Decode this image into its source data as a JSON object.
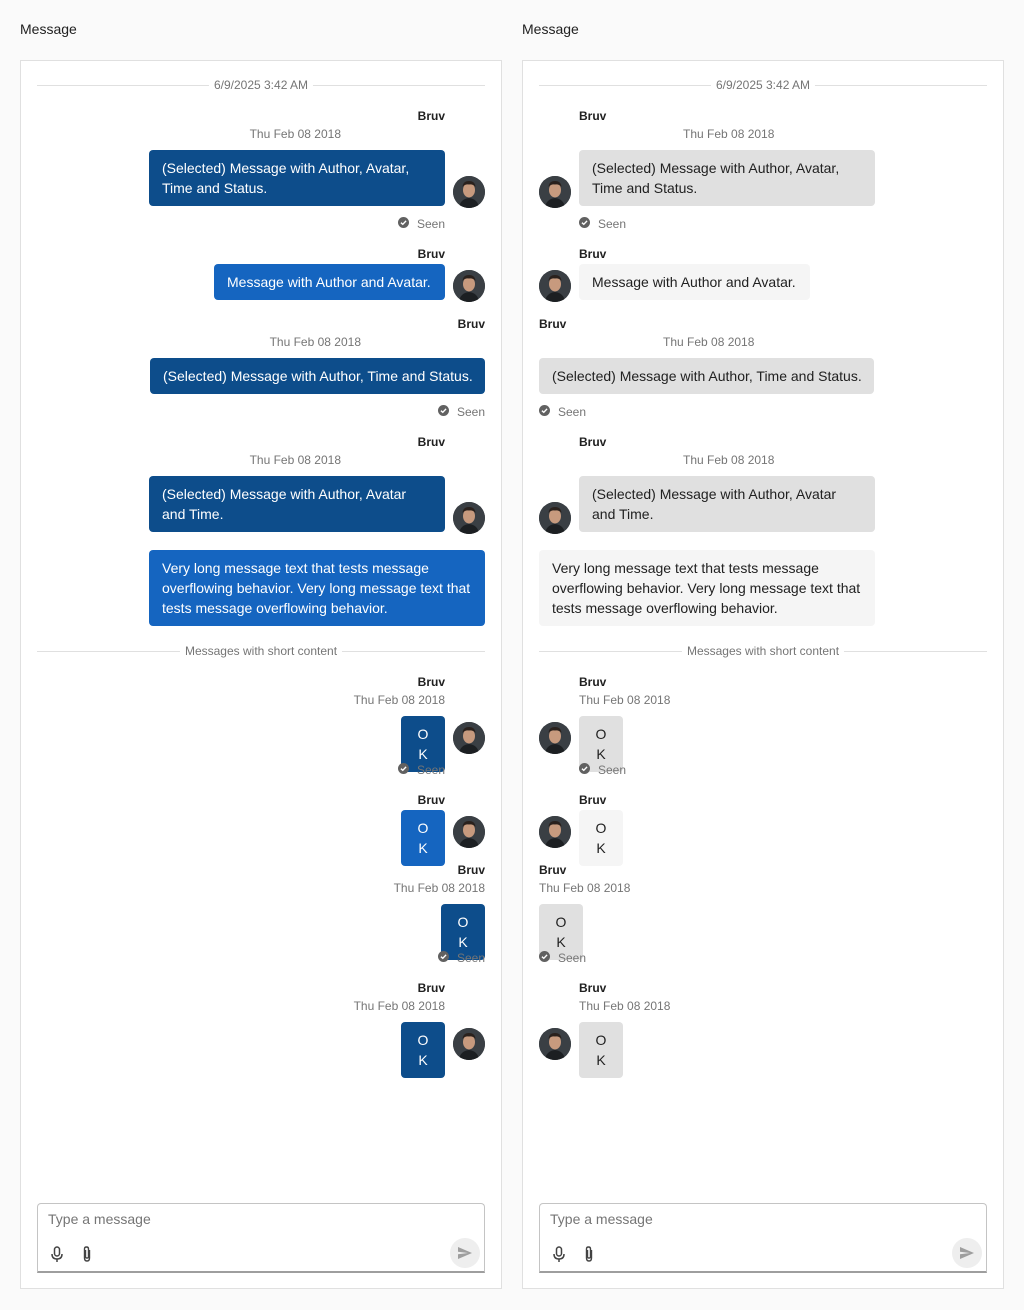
{
  "panels": [
    {
      "title": "Message",
      "side": "right"
    },
    {
      "title": "Message",
      "side": "left"
    }
  ],
  "thread": {
    "top_divider": "6/9/2025 3:42 AM",
    "short_divider": "Messages with short content",
    "author": "Bruv",
    "time": "Thu Feb 08 2018",
    "status": "Seen",
    "msg1": "(Selected) Message with Author, Avatar, Time and Status.",
    "msg2": "Message with Author and Avatar.",
    "msg3": "(Selected) Message with Author, Time and Status.",
    "msg4": "(Selected) Message with Author, Avatar and Time.",
    "msg5": "Very long message text that tests message overflowing behavior. Very long message text that tests message overflowing behavior.",
    "ok": "OK"
  },
  "composer": {
    "placeholder": "Type a message",
    "icons": [
      "microphone-icon",
      "paperclip-icon",
      "send-icon"
    ]
  },
  "colors": {
    "selected_outgoing": "#0d4d8b",
    "outgoing": "#1565c0",
    "selected_incoming": "#e0e0e0",
    "incoming": "#f5f5f5"
  }
}
